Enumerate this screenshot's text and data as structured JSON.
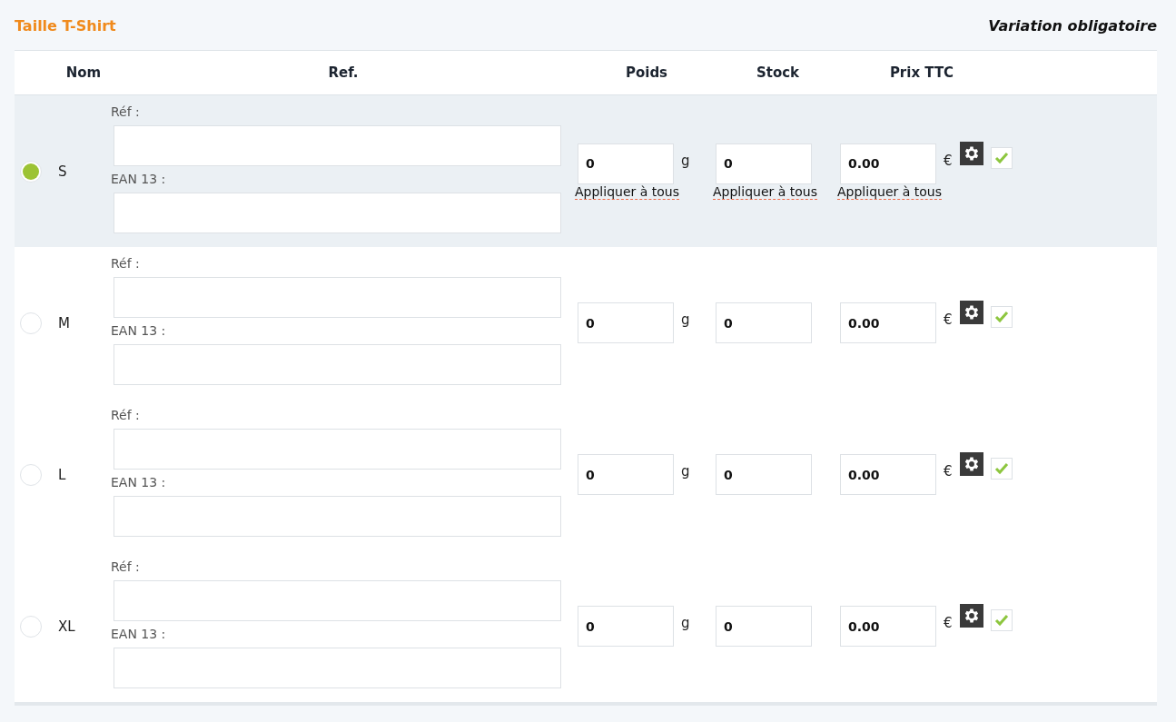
{
  "section": {
    "title": "Taille T-Shirt",
    "note": "Variation obligatoire"
  },
  "columns": [
    "Nom",
    "Ref.",
    "Poids",
    "Stock",
    "Prix TTC"
  ],
  "rows": [
    {
      "name": "S",
      "selected": true,
      "ref_label": "Réf :",
      "ean_label": "EAN 13 :",
      "weight": "0",
      "weight_unit": "g",
      "stock": "0",
      "price": "0.00",
      "currency": "€",
      "checked": true,
      "apply_links": [
        "Appliquer à tous",
        "Appliquer à tous",
        "Appliquer à tous"
      ]
    },
    {
      "name": "M",
      "selected": false,
      "ref_label": "Réf :",
      "ean_label": "EAN 13 :",
      "weight": "0",
      "weight_unit": "g",
      "stock": "0",
      "price": "0.00",
      "currency": "€",
      "checked": true
    },
    {
      "name": "L",
      "selected": false,
      "ref_label": "Réf :",
      "ean_label": "EAN 13 :",
      "weight": "0",
      "weight_unit": "g",
      "stock": "0",
      "price": "0.00",
      "currency": "€",
      "checked": true
    },
    {
      "name": "XL",
      "selected": false,
      "ref_label": "Réf :",
      "ean_label": "EAN 13 :",
      "weight": "0",
      "weight_unit": "g",
      "stock": "0",
      "price": "0.00",
      "currency": "€",
      "checked": true
    }
  ]
}
